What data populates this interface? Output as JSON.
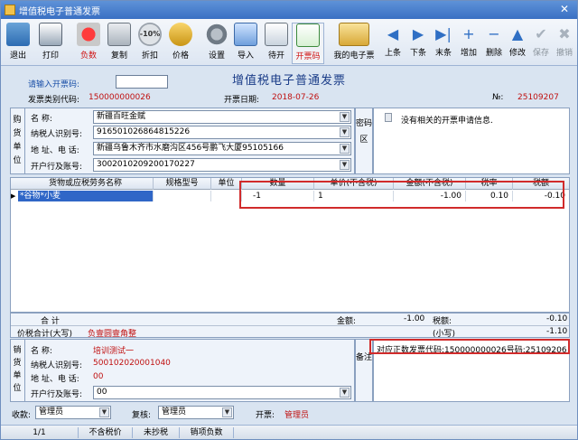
{
  "window": {
    "title": "增值税电子普通发票",
    "close_glyph": "✕"
  },
  "toolbar": {
    "buttons": [
      {
        "label": "退出",
        "icon": "exit-icon"
      },
      {
        "label": "打印",
        "icon": "printer-icon"
      },
      {
        "label": "负数",
        "icon": "negative-icon"
      },
      {
        "label": "复制",
        "icon": "copy-icon"
      },
      {
        "label": "折扣",
        "icon": "discount-icon",
        "badge": "-10%"
      },
      {
        "label": "价格",
        "icon": "price-icon"
      },
      {
        "label": "设置",
        "icon": "settings-icon"
      },
      {
        "label": "导入",
        "icon": "import-icon"
      },
      {
        "label": "待开",
        "icon": "pending-icon"
      },
      {
        "label": "开票码",
        "icon": "qr-code-icon"
      },
      {
        "label": "我的电子票",
        "icon": "my-einvoice-icon"
      }
    ],
    "nav": [
      {
        "label": "上条",
        "glyph": "◀"
      },
      {
        "label": "下条",
        "glyph": "▶"
      },
      {
        "label": "末条",
        "glyph": "▶|"
      },
      {
        "label": "增加",
        "glyph": "+"
      },
      {
        "label": "删除",
        "glyph": "−"
      },
      {
        "label": "修改",
        "glyph": "▲"
      },
      {
        "label": "保存",
        "glyph": "✔",
        "disabled": true
      },
      {
        "label": "撤销",
        "glyph": "✖",
        "disabled": true
      }
    ]
  },
  "header": {
    "invoice_title": "增值税电子普通发票",
    "code_prompt": "请输入开票码:",
    "code_value": "",
    "type_code_label": "发票类别代码:",
    "type_code_value": "150000000026",
    "date_label": "开票日期:",
    "date_value": "2018-07-26",
    "no_label": "№:",
    "no_value": "25109207"
  },
  "buyer": {
    "vlabel": "购货单位",
    "name_label": "名      称:",
    "name_value": "新疆百旺金赋",
    "tax_label": "纳税人识别号:",
    "tax_value": "916501026864815226",
    "addr_label": "地 址、电 话:",
    "addr_value": "新疆乌鲁木齐市水磨沟区456号鹏飞大厦95105166",
    "bank_label": "开户行及账号:",
    "bank_value": "300201020920017​0227"
  },
  "password_area": {
    "vlabel": "密码区",
    "message": "没有相关的开票申请信息."
  },
  "grid": {
    "columns": [
      "货物或应税劳务名称",
      "规格型号",
      "单位",
      "数量",
      "单价(不含税)",
      "金额(不含税)",
      "税率",
      "税额"
    ],
    "rows": [
      {
        "marker": "▶",
        "name": "*谷物*小麦",
        "spec": "",
        "unit": "",
        "qty": "-1",
        "price": "1",
        "amount": "-1.00",
        "rate": "0.10",
        "tax": "-0.10"
      }
    ]
  },
  "totals": {
    "sum_label": "合      计",
    "amount_label": "金额:",
    "amount_value": "-1.00",
    "tax_label": "税额:",
    "tax_value": "-0.10",
    "total_label": "价税合计(大写)",
    "total_upper": "负壹圆壹角整",
    "small_label": "(小写)",
    "small_value": "-1.10"
  },
  "seller": {
    "vlabel": "销货单位",
    "name_label": "名      称:",
    "name_value": "培训测试一",
    "tax_label": "纳税人识别号:",
    "tax_value": "500102020001040",
    "addr_label": "地 址、电 话:",
    "addr_value": "00",
    "bank_label": "开户行及账号:",
    "bank_value": "00"
  },
  "note_area": {
    "vlabel": "备注",
    "text": "对应正数发票代码:150000000026号码:25109206"
  },
  "footer": {
    "payee_label": "收款:",
    "payee_value": "管理员",
    "reviewer_label": "复核:",
    "reviewer_value": "管理员",
    "drawer_label": "开票:",
    "drawer_value": "管理员"
  },
  "status": {
    "page": "1/1",
    "price_mode": "不含税价",
    "copy_mode": "未抄税",
    "neg_mode": "销项负数"
  }
}
